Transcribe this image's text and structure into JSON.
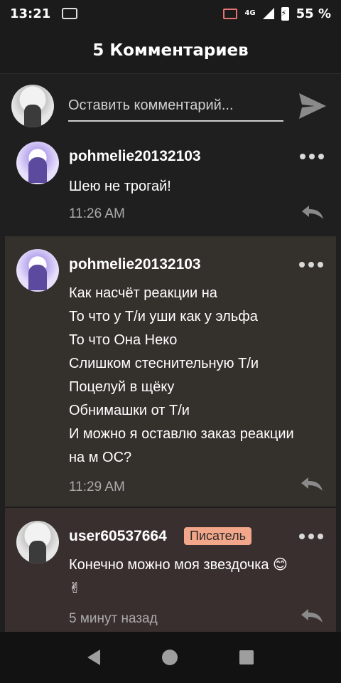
{
  "status_bar": {
    "time": "13:21",
    "network": "4G",
    "battery": "55 %"
  },
  "header": {
    "title": "5 Комментариев"
  },
  "composer": {
    "placeholder": "Оставить комментарий..."
  },
  "comments": [
    {
      "author": "pohmelie20132103",
      "lines": [
        "Шею не трогай!"
      ],
      "time": "11:26 AM"
    },
    {
      "author": "pohmelie20132103",
      "lines": [
        "Как насчёт реакции на",
        "То что у Т/и уши как у эльфа",
        "То что Она Неко",
        "Слишком стеснительную Т/и",
        "Поцелуй в щёку",
        "Обнимашки от Т/и",
        "И можно я оставлю заказ реакции",
        "на м ОС?"
      ],
      "time": "11:29 AM"
    },
    {
      "author": "user60537664",
      "badge": "Писатель",
      "lines": [
        "Конечно можно моя звездочка 😊",
        "✌"
      ],
      "time": "5 минут назад"
    }
  ],
  "colors": {
    "background": "#1f1f1f",
    "highlight_comment": "#34302c",
    "reply_comment": "#3a2f2f",
    "badge": "#f2a68a"
  }
}
